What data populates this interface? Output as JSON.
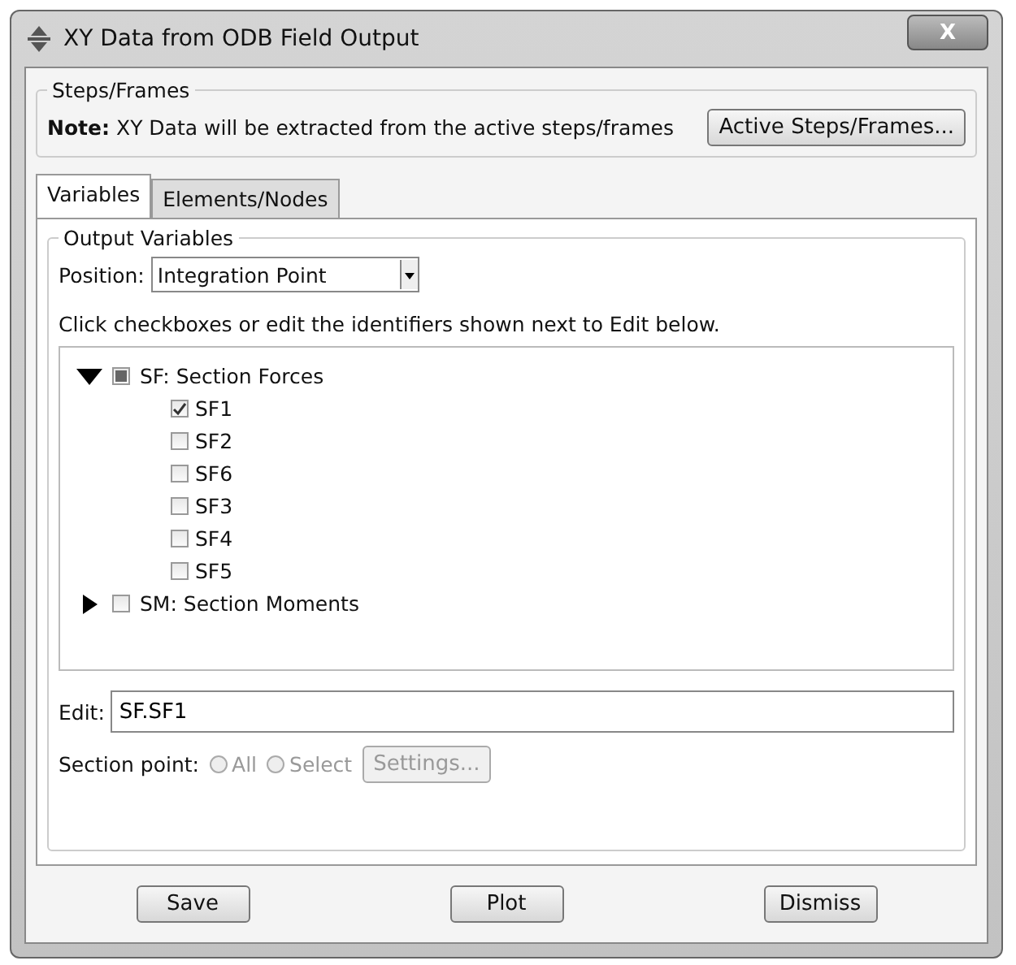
{
  "window": {
    "title": "XY Data from ODB Field Output",
    "close": "X"
  },
  "steps_frames": {
    "title": "Steps/Frames",
    "note_label": "Note:",
    "note": "XY Data will be extracted from the active steps/frames",
    "button": "Active Steps/Frames..."
  },
  "tabs": [
    {
      "label": "Variables",
      "selected": true
    },
    {
      "label": "Elements/Nodes",
      "selected": false
    }
  ],
  "output_variables": {
    "title": "Output Variables",
    "position_label": "Position:",
    "position_value": "Integration Point",
    "hint": "Click checkboxes or edit the identifiers shown next to Edit below.",
    "tree": [
      {
        "label": "SF: Section Forces",
        "expanded": true,
        "checked": false,
        "partial": true,
        "children": [
          {
            "label": "SF1",
            "checked": true
          },
          {
            "label": "SF2",
            "checked": false
          },
          {
            "label": "SF6",
            "checked": false
          },
          {
            "label": "SF3",
            "checked": false
          },
          {
            "label": "SF4",
            "checked": false
          },
          {
            "label": "SF5",
            "checked": false
          }
        ]
      },
      {
        "label": "SM: Section Moments",
        "expanded": false,
        "checked": false,
        "partial": false
      }
    ],
    "edit_label": "Edit:",
    "edit_value": "SF.SF1",
    "section_point_label": "Section point:",
    "section_point_options": [
      {
        "label": "All",
        "selected": false,
        "disabled": true
      },
      {
        "label": "Select",
        "selected": false,
        "disabled": true
      }
    ],
    "settings_button": {
      "label": "Settings...",
      "disabled": true
    }
  },
  "buttons": [
    "Save",
    "Plot",
    "Dismiss"
  ]
}
